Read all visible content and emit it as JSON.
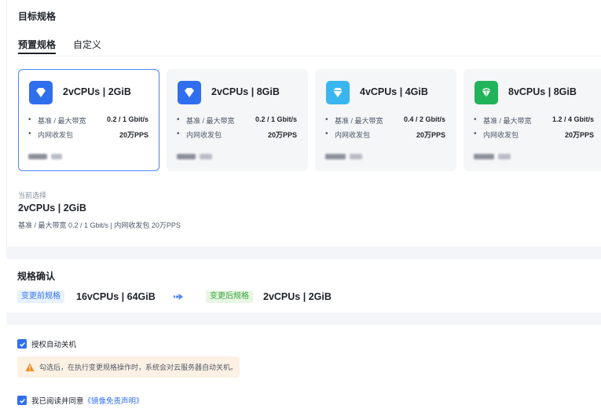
{
  "target_spec": {
    "title": "目标规格",
    "tabs": [
      {
        "label": "预置规格",
        "active": true
      },
      {
        "label": "自定义",
        "active": false
      }
    ],
    "cards": [
      {
        "name": "2vCPUs | 2GiB",
        "icon": "diamond-icon",
        "icon_color": "#2f6fed",
        "selected": true,
        "specs": [
          {
            "key": "基准 / 最大带宽",
            "value": "0.2 / 1 Gbit/s"
          },
          {
            "key": "内网收发包",
            "value": "20万PPS"
          }
        ]
      },
      {
        "name": "2vCPUs | 8GiB",
        "icon": "diamond-icon",
        "icon_color": "#2f6fed",
        "selected": false,
        "specs": [
          {
            "key": "基准 / 最大带宽",
            "value": "0.2 / 1 Gbit/s"
          },
          {
            "key": "内网收发包",
            "value": "20万PPS"
          }
        ]
      },
      {
        "name": "4vCPUs | 4GiB",
        "icon": "diamond-icon",
        "icon_color": "#39b5ef",
        "selected": false,
        "specs": [
          {
            "key": "基准 / 最大带宽",
            "value": "0.4 / 2 Gbit/s"
          },
          {
            "key": "内网收发包",
            "value": "20万PPS"
          }
        ]
      },
      {
        "name": "8vCPUs | 8GiB",
        "icon": "gem-icon",
        "icon_color": "#21b35a",
        "selected": false,
        "specs": [
          {
            "key": "基准 / 最大带宽",
            "value": "1.2 / 4 Gbit/s"
          },
          {
            "key": "内网收发包",
            "value": "20万PPS"
          }
        ]
      }
    ],
    "current": {
      "label": "当前选择",
      "name": "2vCPUs | 2GiB",
      "desc": "基准 / 最大带宽  0.2 / 1 Gbit/s  |  内网收发包  20万PPS"
    }
  },
  "confirm": {
    "title": "规格确认",
    "before_label": "变更前规格",
    "before_value": "16vCPUs | 64GiB",
    "arrow_icon": "arrow-right-icon",
    "after_label": "变更后规格",
    "after_value": "2vCPUs | 2GiB"
  },
  "agreement": {
    "auto_shutdown_label": "授权自动关机",
    "auto_shutdown_checked": true,
    "warning_text": "勾选后，在执行变更规格操作时，系统会对云服务器自动关机。",
    "agree_prefix": "我已阅读并同意",
    "agree_link": "《镜像免责声明》",
    "agree_checked": true
  }
}
